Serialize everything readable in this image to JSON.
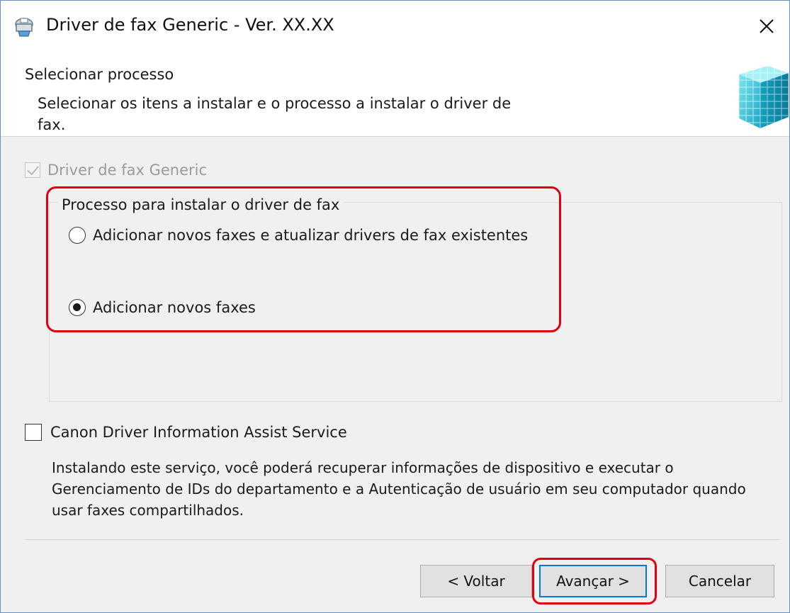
{
  "window": {
    "title": "Driver de fax Generic - Ver. XX.XX",
    "icon": "installer-app-icon",
    "close_icon": "close-icon"
  },
  "header": {
    "title": "Selecionar processo",
    "description": "Selecionar os itens a instalar e o processo a instalar o driver de fax.",
    "icon": "cube-icon"
  },
  "driver_checkbox": {
    "label": "Driver de fax Generic",
    "checked": true,
    "disabled": true
  },
  "process_group": {
    "legend": "Processo para instalar o driver de fax",
    "options": [
      {
        "label": "Adicionar novos faxes e atualizar drivers de fax existentes",
        "selected": false
      },
      {
        "label": "Adicionar novos faxes",
        "selected": true
      }
    ]
  },
  "assist_service": {
    "label": "Canon Driver Information Assist Service",
    "checked": false,
    "description": "Instalando este serviço, você poderá recuperar informações de dispositivo e executar o Gerenciamento de IDs do departamento e a Autenticação de usuário em seu computador quando usar faxes compartilhados."
  },
  "buttons": {
    "back": "< Voltar",
    "next": "Avançar >",
    "cancel": "Cancelar"
  },
  "colors": {
    "highlight": "#e00010",
    "focus_border": "#0078d7"
  }
}
